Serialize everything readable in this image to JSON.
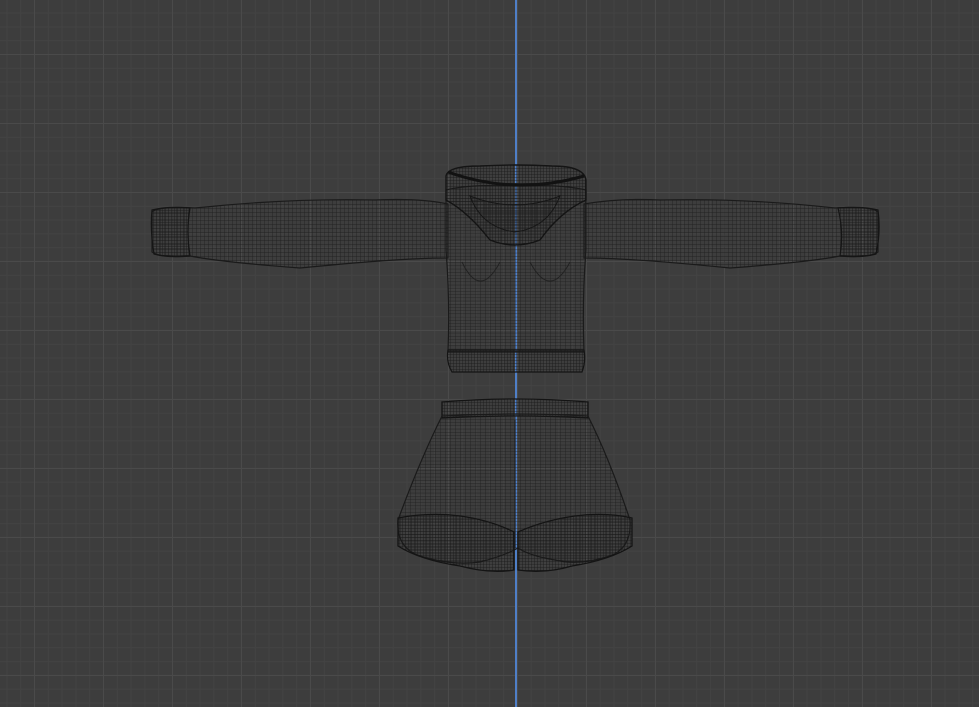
{
  "viewport": {
    "mode": "wireframe",
    "background_color": "#3d3d3d",
    "grid_major_color": "#4a4a4a",
    "grid_minor_color": "#434343",
    "axis_color": "#4f7fc7",
    "wire_color": "#1c1c1c"
  },
  "objects": [
    {
      "name": "cropped-hoodie",
      "type": "mesh"
    },
    {
      "name": "shorts",
      "type": "mesh"
    }
  ]
}
